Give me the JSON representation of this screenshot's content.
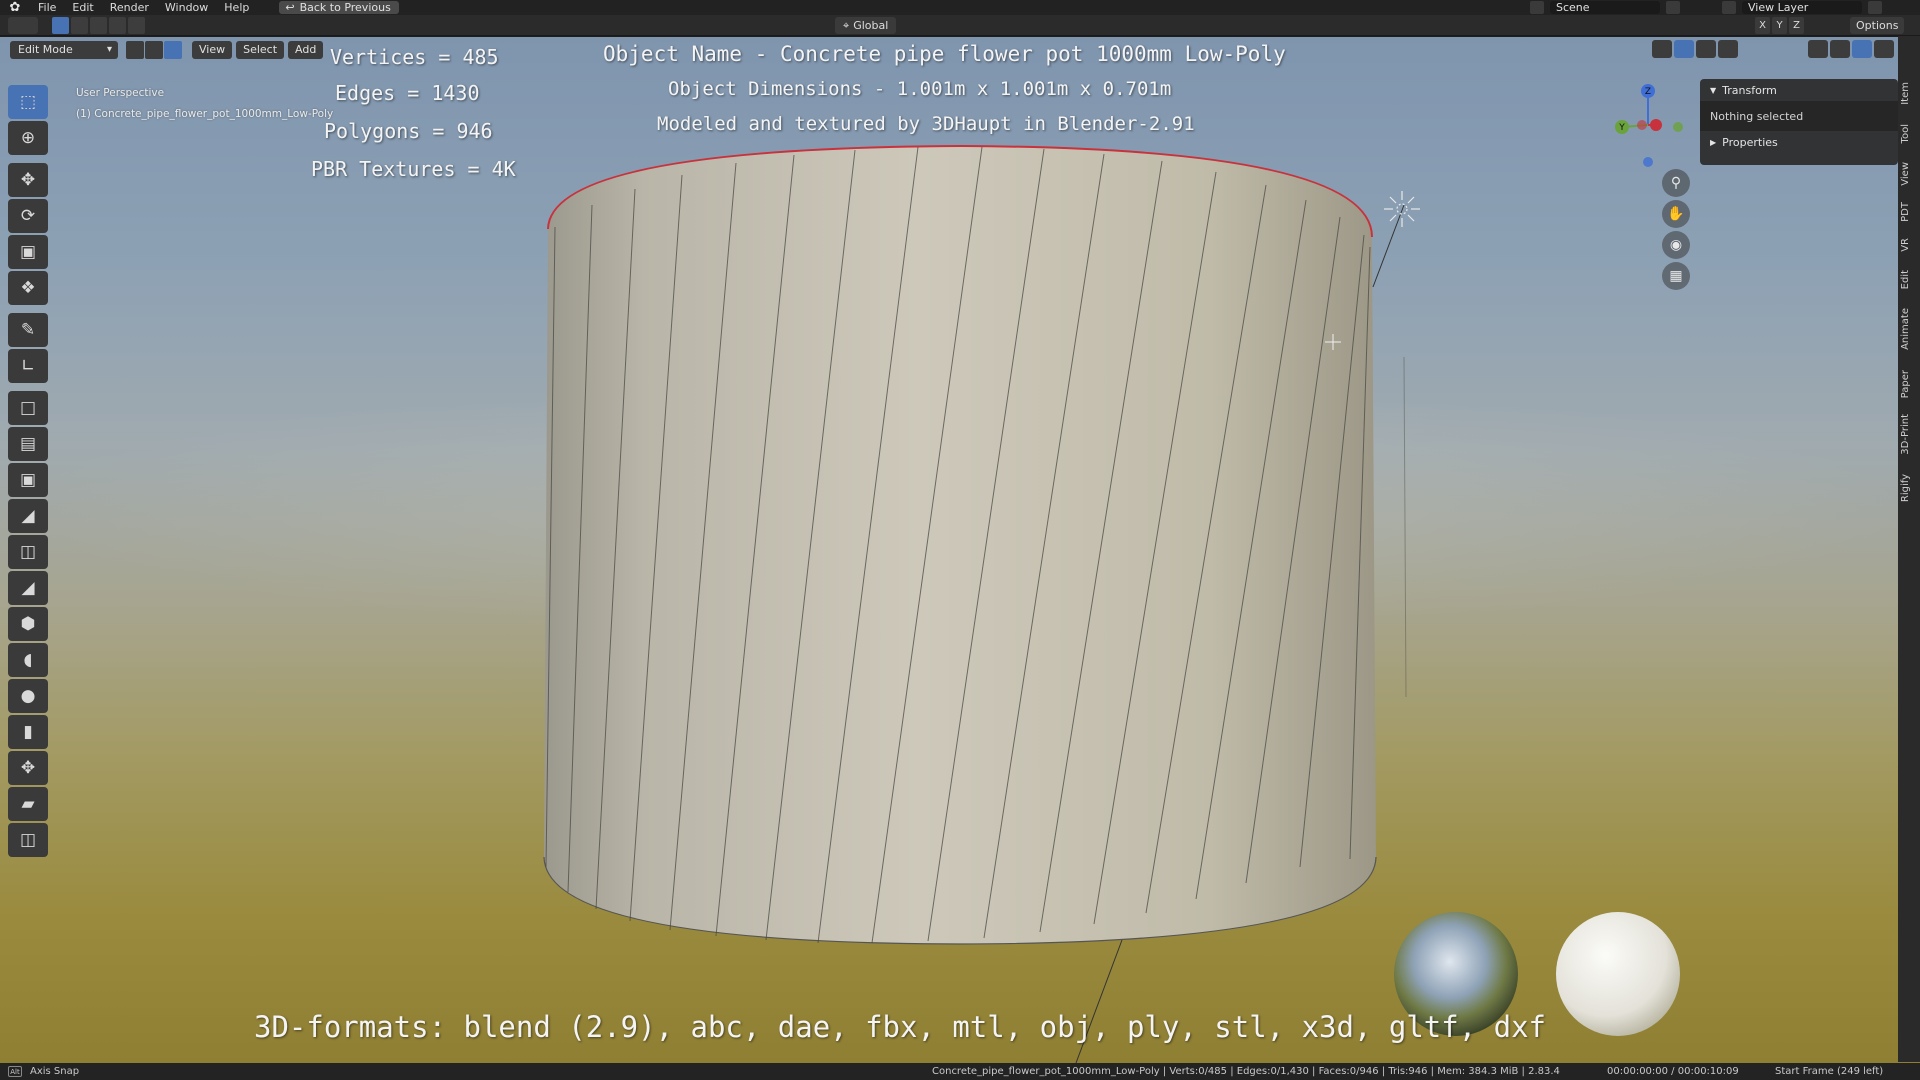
{
  "menu": {
    "items": [
      "File",
      "Edit",
      "Render",
      "Window",
      "Help"
    ],
    "back_button": "Back to Previous",
    "scene": "Scene",
    "view_layer": "View Layer"
  },
  "tool_settings": {
    "orientation": "Global",
    "axes": [
      "X",
      "Y",
      "Z"
    ],
    "options": "Options"
  },
  "viewport_header": {
    "mode": "Edit Mode",
    "menus": [
      "View",
      "Select",
      "Add"
    ]
  },
  "viewport_info": {
    "perspective": "User Perspective",
    "object": "(1) Concrete_pipe_flower_pot_1000mm_Low-Poly"
  },
  "overlay": {
    "object_name": "Object Name - Concrete pipe flower pot 1000mm Low-Poly",
    "dimensions": "Object Dimensions -  1.001m x 1.001m x 0.701m",
    "credit": "Modeled and textured by 3DHaupt in Blender-2.91",
    "vertices": "Vertices = 485",
    "edges": "Edges = 1430",
    "polygons": "Polygons = 946",
    "textures": "PBR Textures = 4K",
    "formats": "3D-formats: blend (2.9), abc, dae, fbx, mtl, obj, ply, stl, x3d, gltf, dxf"
  },
  "npanel": {
    "transform": "Transform",
    "nothing_selected": "Nothing selected",
    "properties": "Properties",
    "tabs": [
      "Item",
      "Tool",
      "View",
      "PDT",
      "VR",
      "Edit",
      "Animate",
      "Paper",
      "3D-Print",
      "Rigify"
    ]
  },
  "gizmo": {
    "y_label": "Y",
    "z_label": "Z"
  },
  "statusbar": {
    "key": "Alt",
    "hint": "Axis Snap",
    "stats": "Concrete_pipe_flower_pot_1000mm_Low-Poly | Verts:0/485 | Edges:0/1,430 | Faces:0/946 | Tris:946 | Mem: 384.3 MiB | 2.83.4",
    "time": "00:00:00:00 / 00:00:10:09",
    "frame": "Start Frame (249 left)"
  },
  "colors": {
    "accent": "#4772b3",
    "edge_select": "#c8323c",
    "sky_top": "#7f95ae",
    "ground": "#8f7f33"
  }
}
